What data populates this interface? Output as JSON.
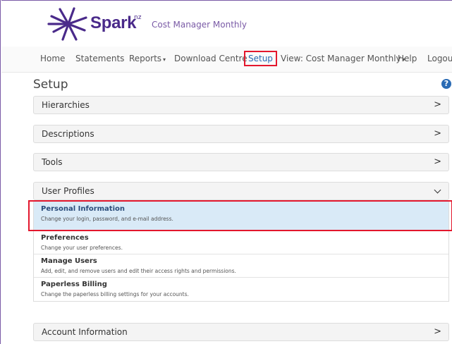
{
  "brand": {
    "name": "Spark",
    "superscript": "nz",
    "product": "Cost Manager Monthly"
  },
  "nav": {
    "items": [
      {
        "label": "Home",
        "dropdown": false,
        "active": false
      },
      {
        "label": "Statements",
        "dropdown": false,
        "active": false
      },
      {
        "label": "Reports",
        "dropdown": true,
        "active": false
      },
      {
        "label": "Download Centre",
        "dropdown": false,
        "active": false
      },
      {
        "label": "Setup",
        "dropdown": false,
        "active": true
      },
      {
        "label": "View: Cost Manager Monthly",
        "dropdown": true,
        "active": false
      },
      {
        "label": "Help",
        "dropdown": false,
        "active": false
      },
      {
        "label": "Logout",
        "dropdown": false,
        "active": false
      }
    ]
  },
  "page": {
    "title": "Setup",
    "help_icon": "?"
  },
  "panels": {
    "hierarchies": {
      "label": "Hierarchies",
      "chevron": ">"
    },
    "descriptions": {
      "label": "Descriptions",
      "chevron": ">"
    },
    "tools": {
      "label": "Tools",
      "chevron": ">"
    },
    "user_profiles": {
      "label": "User Profiles",
      "expanded": true
    },
    "account_information": {
      "label": "Account Information",
      "chevron": ">"
    }
  },
  "user_profiles_items": [
    {
      "title": "Personal Information",
      "description": "Change your login, password, and e-mail address.",
      "selected": true
    },
    {
      "title": "Preferences",
      "description": "Change your user preferences.",
      "selected": false
    },
    {
      "title": "Manage Users",
      "description": "Add, edit, and remove users and edit their access rights and permissions.",
      "selected": false
    },
    {
      "title": "Paperless Billing",
      "description": "Change the paperless billing settings for your accounts.",
      "selected": false
    }
  ],
  "colors": {
    "brand": "#4a2a8a",
    "link": "#2a6bb4",
    "annotation_red": "#e3172d",
    "selected_row": "#d9eaf7"
  }
}
